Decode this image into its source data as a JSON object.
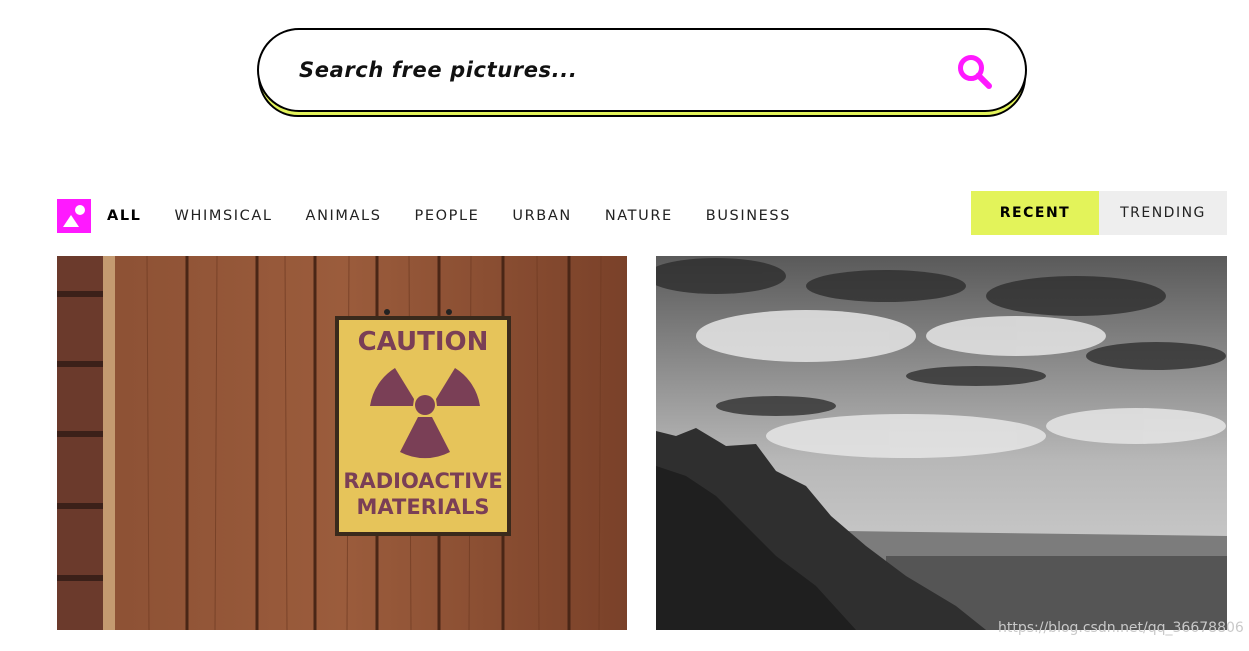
{
  "search": {
    "placeholder": "Search free pictures...",
    "icon": "search-icon"
  },
  "colors": {
    "accent": "#e3f35a",
    "brand": "#ff19ff",
    "trending_bg": "#eeeeee"
  },
  "filters": {
    "logo_icon": "image-icon",
    "items": [
      {
        "label": "ALL",
        "active": true
      },
      {
        "label": "WHIMSICAL"
      },
      {
        "label": "ANIMALS"
      },
      {
        "label": "PEOPLE"
      },
      {
        "label": "URBAN"
      },
      {
        "label": "NATURE"
      },
      {
        "label": "BUSINESS"
      }
    ]
  },
  "sort": {
    "recent_label": "RECENT",
    "trending_label": "TRENDING"
  },
  "photos": [
    {
      "sign_top": "CAUTION",
      "sign_line1": "RADIOACTIVE",
      "sign_line2": "MATERIALS"
    },
    {}
  ],
  "watermark": "https://blog.csdn.net/qq_36678806"
}
